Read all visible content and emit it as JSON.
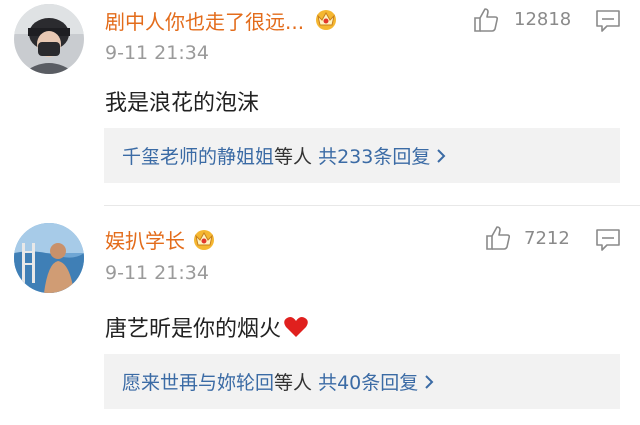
{
  "comments": [
    {
      "username": "剧中人你也走了很远...",
      "timestamp": "9-11 21:34",
      "likes": "12818",
      "text": "我是浪花的泡沫",
      "reply_names": "千玺老师的静姐姐",
      "reply_and": "等人",
      "reply_count": "共233条回复",
      "avatar_icon": "avatar-photo",
      "badge_icon": "vip-crown-icon"
    },
    {
      "username": "娱扒学长",
      "timestamp": "9-11 21:34",
      "likes": "7212",
      "text": "唐艺昕是你的烟火",
      "emoji": "red-heart",
      "reply_names": "愿来世再与妳轮回",
      "reply_and": "等人",
      "reply_count": "共40条回复",
      "avatar_icon": "avatar-photo",
      "badge_icon": "vip-crown-icon"
    }
  ],
  "colors": {
    "username": "#e36c1b",
    "reply_link": "#3b6ba5",
    "timestamp": "#9a9a9a",
    "reply_bg": "#f2f2f2",
    "heart": "#e0201e"
  }
}
